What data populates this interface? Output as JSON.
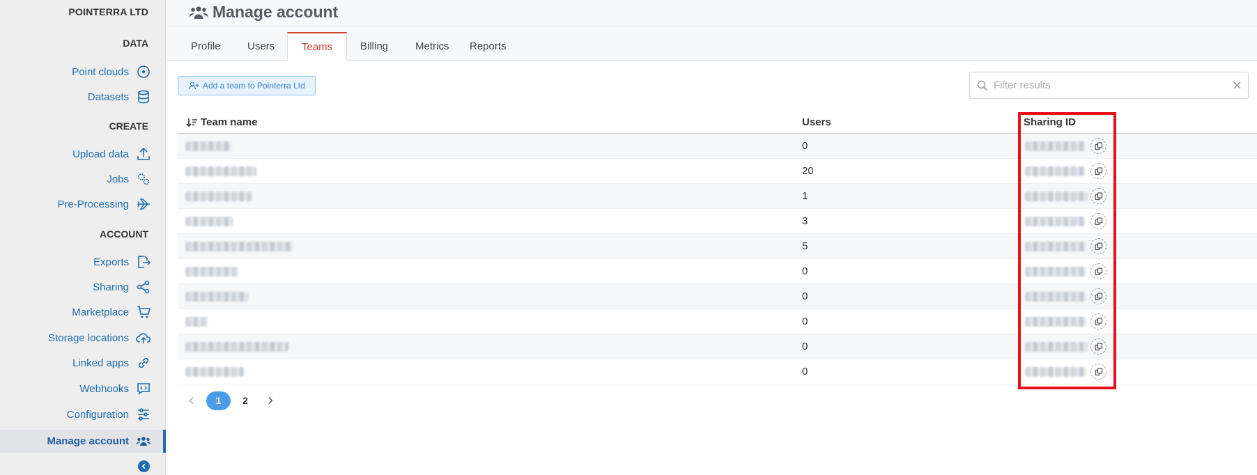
{
  "sidebar": {
    "brand": "POINTERRA LTD",
    "sections": {
      "data": "DATA",
      "create": "CREATE",
      "account": "ACCOUNT"
    },
    "items": {
      "point_clouds": "Point clouds",
      "datasets": "Datasets",
      "upload_data": "Upload data",
      "jobs": "Jobs",
      "pre_processing": "Pre-Processing",
      "exports": "Exports",
      "sharing": "Sharing",
      "marketplace": "Marketplace",
      "storage_locations": "Storage locations",
      "linked_apps": "Linked apps",
      "webhooks": "Webhooks",
      "configuration": "Configuration",
      "manage_account": "Manage account"
    }
  },
  "header": {
    "title": "Manage account"
  },
  "tabs": [
    "Profile",
    "Users",
    "Teams",
    "Billing",
    "Metrics",
    "Reports"
  ],
  "active_tab": "Teams",
  "toolbar": {
    "add_team_label": "Add a team to Pointerra Ltd",
    "filter_placeholder": "Filter results"
  },
  "table": {
    "columns": {
      "team_name": "Team name",
      "users": "Users",
      "sharing_id": "Sharing ID"
    },
    "rows": [
      {
        "users": "0"
      },
      {
        "users": "20"
      },
      {
        "users": "1"
      },
      {
        "users": "3"
      },
      {
        "users": "5"
      },
      {
        "users": "0"
      },
      {
        "users": "0"
      },
      {
        "users": "0"
      },
      {
        "users": "0"
      },
      {
        "users": "0"
      }
    ]
  },
  "pagination": {
    "pages": [
      "1",
      "2"
    ],
    "current": "1"
  },
  "colors": {
    "accent": "#1f6fb2",
    "active_tab": "#c23d25",
    "highlight": "#e8101a",
    "pager_active": "#4a9ce8"
  }
}
